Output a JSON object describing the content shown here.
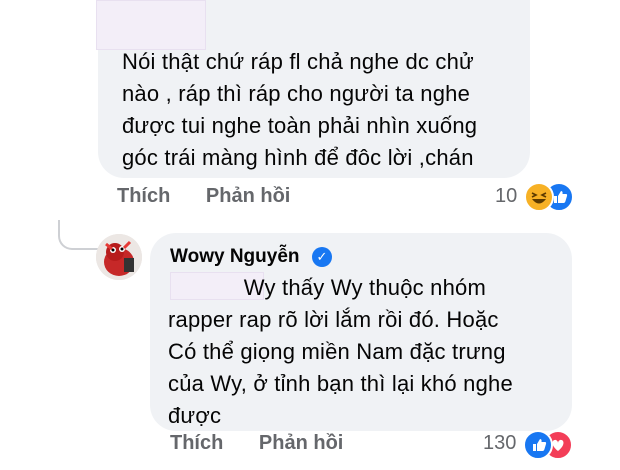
{
  "comment1": {
    "text": "Nói thật chứ ráp fl chả nghe dc chử\nnào , ráp thì ráp cho người ta nghe\nđược tui nghe toàn phải nhìn xuống\ngóc trái màng hình để đôc lời ,chán",
    "like_label": "Thích",
    "reply_label": "Phản hồi",
    "reaction_count": "10",
    "reactions": [
      "laugh-icon",
      "like-icon"
    ]
  },
  "comment2": {
    "author": "Wowy Nguyễn",
    "text": "            Wy thấy Wy thuộc nhóm\nrapper rap rõ lời lắm rồi đó. Hoặc\nCó thể giọng miền Nam đặc trưng\ncủa Wy, ở tỉnh bạn thì lại khó nghe\nđược",
    "like_label": "Thích",
    "reply_label": "Phản hồi",
    "reaction_count": "130",
    "reactions": [
      "like-icon",
      "love-icon"
    ]
  },
  "colors": {
    "bubble": "#f0f2f5",
    "meta_text": "#65676b",
    "like_blue": "#1877f2",
    "love_red": "#f33e58",
    "laugh_yellow": "#f7b125"
  }
}
